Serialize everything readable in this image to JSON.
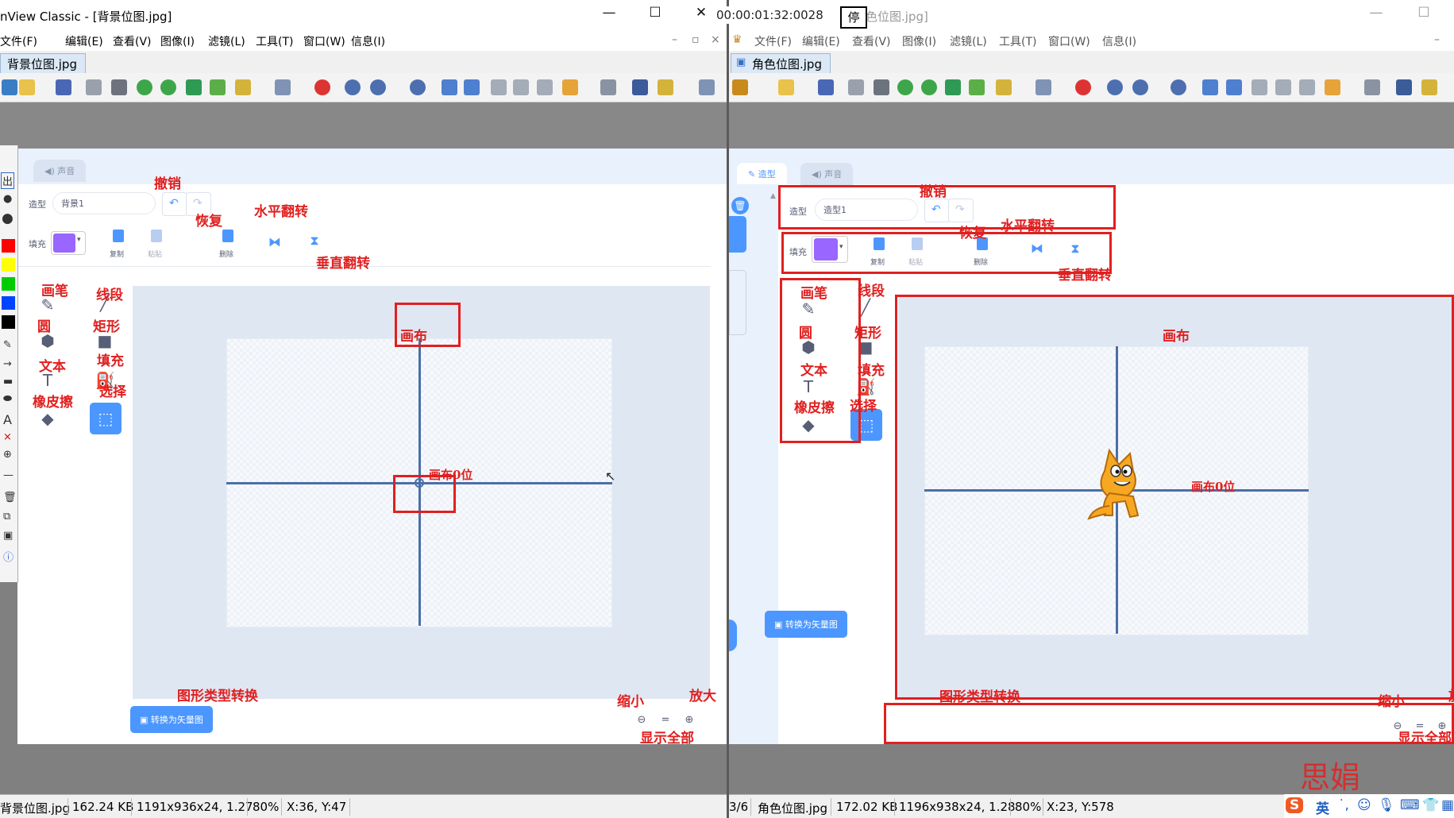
{
  "left_window": {
    "title": "nView Classic - [背景位图.jpg]",
    "menus": [
      "文件(F)",
      "编辑(E)",
      "查看(V)",
      "图像(I)",
      "滤镜(L)",
      "工具(T)",
      "窗口(W)",
      "信息(I)"
    ],
    "file_tab": "背景位图.jpg",
    "status": {
      "file": "背景位图.jpg",
      "size": "162.24 KB",
      "dims": "1191x936x24, 1.27",
      "zoom": "80%",
      "coords": "X:36, Y:47"
    }
  },
  "right_window": {
    "title": "色位图.jpg]",
    "menus": [
      "文件(F)",
      "编辑(E)",
      "查看(V)",
      "图像(I)",
      "滤镜(L)",
      "工具(T)",
      "窗口(W)",
      "信息(I)"
    ],
    "file_tab": "角色位图.jpg",
    "status": {
      "index": "3/6",
      "file": "角色位图.jpg",
      "size": "172.02 KB",
      "dims": "1196x938x24, 1.28",
      "zoom": "80%",
      "coords": "X:23, Y:578"
    }
  },
  "recorder": {
    "timer": "00:00:01:32:0028",
    "stop_label": "停"
  },
  "left_palette": {
    "top_label": "出",
    "swatches": [
      "#ff0000",
      "#ffff00",
      "#00cc00",
      "#0044ff",
      "#000000"
    ],
    "text_tool": "A",
    "close_mark": "×"
  },
  "scratch_left": {
    "tab_sound": "声音",
    "costume_label": "造型",
    "costume_name": "背景1",
    "fill_label": "填充",
    "fill_color": "#9966ff",
    "copy_label": "复制",
    "paste_label": "粘贴",
    "delete_label": "删除",
    "convert_label": "转换为矢量图",
    "zoom_out": "−",
    "zoom_reset": "=",
    "zoom_in": "+"
  },
  "scratch_right": {
    "tab_costume": "造型",
    "tab_sound": "声音",
    "costume_label": "造型",
    "costume_name": "造型1",
    "fill_label": "填充",
    "fill_color": "#9966ff",
    "copy_label": "复制",
    "paste_label": "粘贴",
    "delete_label": "删除",
    "convert_label": "转换为矢量图"
  },
  "annotations_left": {
    "undo": "撤销",
    "redo": "恢复",
    "flip_h": "水平翻转",
    "flip_v": "垂直翻转",
    "brush": "画笔",
    "line": "线段",
    "circle": "圆",
    "rect": "矩形",
    "text": "文本",
    "fill": "填充",
    "eraser": "橡皮擦",
    "select": "选择",
    "canvas": "画布",
    "origin": "画布0位",
    "convert": "图形类型转换",
    "zoom_out": "缩小",
    "zoom_in": "放大",
    "show_all": "显示全部"
  },
  "annotations_right": {
    "undo": "撤销",
    "redo": "恢复",
    "flip_h": "水平翻转",
    "flip_v": "垂直翻转",
    "brush": "画笔",
    "line": "线段",
    "circle": "圆",
    "rect": "矩形",
    "text": "文本",
    "fill": "填充",
    "eraser": "橡皮擦",
    "select": "选择",
    "canvas": "画布",
    "origin": "画布0位",
    "convert": "图形类型转换",
    "zoom_out": "缩小",
    "zoom_in": "放",
    "show_all": "显示全部"
  },
  "signature": "思娟",
  "ime": {
    "lang": "英"
  }
}
